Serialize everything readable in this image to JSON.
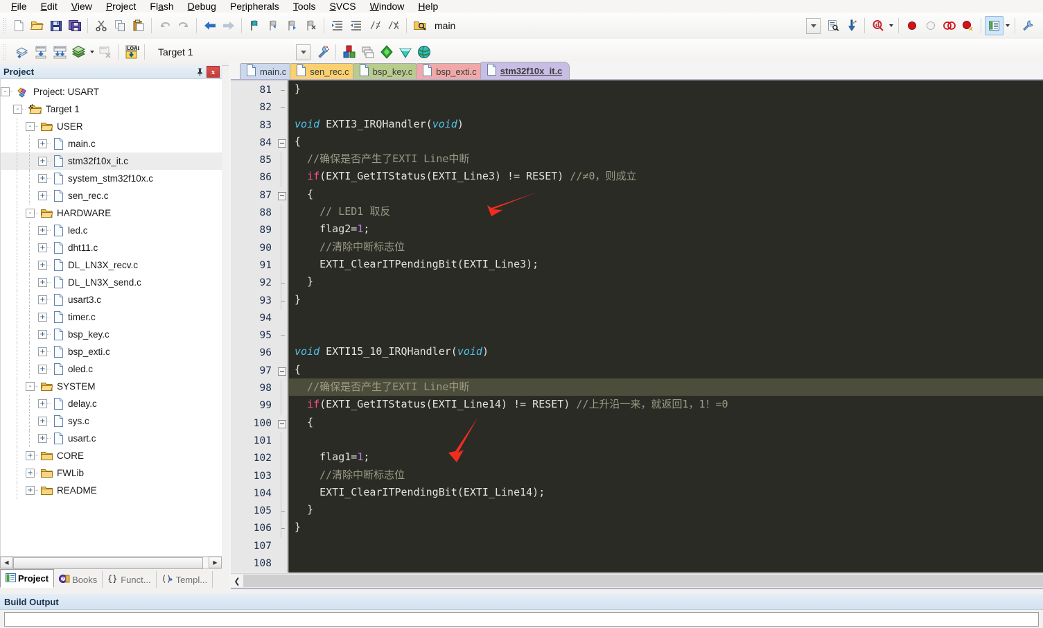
{
  "menubar": {
    "items": [
      "File",
      "Edit",
      "View",
      "Project",
      "Flash",
      "Debug",
      "Peripherals",
      "Tools",
      "SVCS",
      "Window",
      "Help"
    ]
  },
  "toolbar1": {
    "icons": [
      "new-file-icon",
      "open-file-icon",
      "save-icon",
      "save-all-icon",
      "cut-icon",
      "copy-icon",
      "paste-icon",
      "undo-icon",
      "redo-icon",
      "navigate-back-icon",
      "navigate-forward-icon",
      "bookmark-toggle-icon",
      "bookmark-prev-icon",
      "bookmark-next-icon",
      "bookmark-clear-icon",
      "indent-icon",
      "outdent-icon",
      "comment-icon",
      "uncomment-icon",
      "find-in-files-icon"
    ],
    "find_value": "main",
    "find_placeholder": "",
    "right_icons": [
      "combo-dropdown-icon",
      "bookmark-list-icon",
      "insert-icon",
      "debug-search-icon",
      "breakpoint-insert-icon",
      "breakpoint-disable-icon",
      "breakpoint-kill-all-icon",
      "breakpoint-disable-all-icon",
      "window-layout-icon",
      "configure-icon"
    ]
  },
  "toolbar2": {
    "icons": [
      "translate-icon",
      "build-icon",
      "rebuild-icon",
      "batch-build-icon",
      "batch-caret-icon",
      "stop-build-icon",
      "download-icon"
    ],
    "target_value": "Target 1",
    "target_placeholder": "",
    "right_icons": [
      "select-target-arrow-icon",
      "options-target-icon",
      "manage-components-icon",
      "manage-multi-project-icon",
      "pack-installer-icon",
      "run-pack-installer-icon",
      "manage-run-time-env-icon"
    ]
  },
  "project_panel": {
    "title": "Project",
    "pin_icon": "pin-icon",
    "close_icon": "close-icon",
    "tree": [
      {
        "label": "Project: USART",
        "depth": 0,
        "type": "project",
        "expander": "-",
        "selected": false
      },
      {
        "label": "Target 1",
        "depth": 1,
        "type": "target",
        "expander": "-",
        "selected": false
      },
      {
        "label": "USER",
        "depth": 2,
        "type": "group",
        "expander": "-",
        "selected": false
      },
      {
        "label": "main.c",
        "depth": 3,
        "type": "file",
        "expander": "+",
        "selected": false
      },
      {
        "label": "stm32f10x_it.c",
        "depth": 3,
        "type": "file",
        "expander": "+",
        "selected": true
      },
      {
        "label": "system_stm32f10x.c",
        "depth": 3,
        "type": "file",
        "expander": "+",
        "selected": false
      },
      {
        "label": "sen_rec.c",
        "depth": 3,
        "type": "file",
        "expander": "+",
        "selected": false
      },
      {
        "label": "HARDWARE",
        "depth": 2,
        "type": "group",
        "expander": "-",
        "selected": false
      },
      {
        "label": "led.c",
        "depth": 3,
        "type": "file",
        "expander": "+",
        "selected": false
      },
      {
        "label": "dht11.c",
        "depth": 3,
        "type": "file",
        "expander": "+",
        "selected": false
      },
      {
        "label": "DL_LN3X_recv.c",
        "depth": 3,
        "type": "file",
        "expander": "+",
        "selected": false
      },
      {
        "label": "DL_LN3X_send.c",
        "depth": 3,
        "type": "file",
        "expander": "+",
        "selected": false
      },
      {
        "label": "usart3.c",
        "depth": 3,
        "type": "file",
        "expander": "+",
        "selected": false
      },
      {
        "label": "timer.c",
        "depth": 3,
        "type": "file",
        "expander": "+",
        "selected": false
      },
      {
        "label": "bsp_key.c",
        "depth": 3,
        "type": "file",
        "expander": "+",
        "selected": false
      },
      {
        "label": "bsp_exti.c",
        "depth": 3,
        "type": "file",
        "expander": "+",
        "selected": false
      },
      {
        "label": "oled.c",
        "depth": 3,
        "type": "file",
        "expander": "+",
        "selected": false
      },
      {
        "label": "SYSTEM",
        "depth": 2,
        "type": "group",
        "expander": "-",
        "selected": false
      },
      {
        "label": "delay.c",
        "depth": 3,
        "type": "file",
        "expander": "+",
        "selected": false
      },
      {
        "label": "sys.c",
        "depth": 3,
        "type": "file",
        "expander": "+",
        "selected": false
      },
      {
        "label": "usart.c",
        "depth": 3,
        "type": "file",
        "expander": "+",
        "selected": false
      },
      {
        "label": "CORE",
        "depth": 2,
        "type": "folder",
        "expander": "+",
        "selected": false
      },
      {
        "label": "FWLib",
        "depth": 2,
        "type": "folder",
        "expander": "+",
        "selected": false
      },
      {
        "label": "README",
        "depth": 2,
        "type": "folder",
        "expander": "+",
        "selected": false
      }
    ],
    "tabs": [
      {
        "label": "Project",
        "icon": "project-icon",
        "active": true
      },
      {
        "label": "Books",
        "icon": "books-icon",
        "active": false
      },
      {
        "label": "Funct...",
        "icon": "functions-icon",
        "active": false
      },
      {
        "label": "Templ...",
        "icon": "templates-icon",
        "active": false
      }
    ]
  },
  "editor": {
    "file_tabs": [
      {
        "label": "main.c",
        "color": "#ccd8ec",
        "active": false
      },
      {
        "label": "sen_rec.c",
        "color": "#fbd170",
        "active": false
      },
      {
        "label": "bsp_key.c",
        "color": "#b9cc8e",
        "active": false
      },
      {
        "label": "bsp_exti.c",
        "color": "#f0a9a9",
        "active": false
      },
      {
        "label": "stm32f10x_it.c",
        "color": "#c8bde4",
        "active": true
      }
    ],
    "first_line_number": 81,
    "highlight_line": 98,
    "colors": {
      "background": "#2b2b26",
      "gutter": "#e7e7e7",
      "text": "#e3e3dd",
      "comment": "#9a9a86",
      "keyword": "#4fc3e8",
      "control_keyword": "#ff4d88",
      "number": "#b07cf0",
      "current_line": "#4d4d3c",
      "annotation_arrow": "#f22d1e"
    },
    "lines": [
      {
        "n": 81,
        "fold": "end",
        "segs": [
          {
            "t": "}"
          }
        ]
      },
      {
        "n": 82,
        "fold": "tail",
        "segs": []
      },
      {
        "n": 83,
        "fold": "none",
        "segs": [
          {
            "t": "void ",
            "c": "kw"
          },
          {
            "t": "EXTI3_IRQHandler("
          },
          {
            "t": "void",
            "c": "kw"
          },
          {
            "t": ")"
          }
        ]
      },
      {
        "n": 84,
        "fold": "start",
        "segs": [
          {
            "t": "{"
          }
        ]
      },
      {
        "n": 85,
        "fold": "none",
        "segs": [
          {
            "t": "  //确保是否产生了EXTI Line中断",
            "c": "cmt"
          }
        ]
      },
      {
        "n": 86,
        "fold": "none",
        "segs": [
          {
            "t": "  "
          },
          {
            "t": "if",
            "c": "kw2"
          },
          {
            "t": "(EXTI_GetITStatus(EXTI_Line3) != RESET) "
          },
          {
            "t": "//≠0，则成立",
            "c": "cmt"
          }
        ]
      },
      {
        "n": 87,
        "fold": "start",
        "segs": [
          {
            "t": "  {"
          }
        ]
      },
      {
        "n": 88,
        "fold": "none",
        "segs": [
          {
            "t": "    // LED1 取反",
            "c": "cmt"
          }
        ]
      },
      {
        "n": 89,
        "fold": "none",
        "segs": [
          {
            "t": "    flag2="
          },
          {
            "t": "1",
            "c": "num"
          },
          {
            "t": ";"
          }
        ]
      },
      {
        "n": 90,
        "fold": "none",
        "segs": [
          {
            "t": "    //清除中断标志位",
            "c": "cmt"
          }
        ]
      },
      {
        "n": 91,
        "fold": "none",
        "segs": [
          {
            "t": "    EXTI_ClearITPendingBit(EXTI_Line3);"
          }
        ]
      },
      {
        "n": 92,
        "fold": "end",
        "segs": [
          {
            "t": "  }"
          }
        ]
      },
      {
        "n": 93,
        "fold": "end",
        "segs": [
          {
            "t": "}"
          }
        ]
      },
      {
        "n": 94,
        "fold": "none",
        "segs": []
      },
      {
        "n": 95,
        "fold": "tail",
        "segs": []
      },
      {
        "n": 96,
        "fold": "none",
        "segs": [
          {
            "t": "void ",
            "c": "kw"
          },
          {
            "t": "EXTI15_10_IRQHandler("
          },
          {
            "t": "void",
            "c": "kw"
          },
          {
            "t": ")"
          }
        ]
      },
      {
        "n": 97,
        "fold": "start",
        "segs": [
          {
            "t": "{"
          }
        ]
      },
      {
        "n": 98,
        "fold": "none",
        "segs": [
          {
            "t": "  //确保是否产生了EXTI Line中断",
            "c": "cmt"
          }
        ]
      },
      {
        "n": 99,
        "fold": "none",
        "segs": [
          {
            "t": "  "
          },
          {
            "t": "if",
            "c": "kw2"
          },
          {
            "t": "(EXTI_GetITStatus(EXTI_Line14) != RESET) "
          },
          {
            "t": "//上升沿一来，就返回1，1！=0",
            "c": "cmt"
          }
        ]
      },
      {
        "n": 100,
        "fold": "start",
        "segs": [
          {
            "t": "  {"
          }
        ]
      },
      {
        "n": 101,
        "fold": "none",
        "segs": []
      },
      {
        "n": 102,
        "fold": "none",
        "segs": [
          {
            "t": "    flag1="
          },
          {
            "t": "1",
            "c": "num"
          },
          {
            "t": ";"
          }
        ]
      },
      {
        "n": 103,
        "fold": "none",
        "segs": [
          {
            "t": "    //清除中断标志位",
            "c": "cmt"
          }
        ]
      },
      {
        "n": 104,
        "fold": "none",
        "segs": [
          {
            "t": "    EXTI_ClearITPendingBit(EXTI_Line14);"
          }
        ]
      },
      {
        "n": 105,
        "fold": "end",
        "segs": [
          {
            "t": "  }"
          }
        ]
      },
      {
        "n": 106,
        "fold": "end",
        "segs": [
          {
            "t": "}"
          }
        ]
      },
      {
        "n": 107,
        "fold": "none",
        "segs": []
      },
      {
        "n": 108,
        "fold": "none",
        "segs": []
      }
    ],
    "annotations": [
      {
        "name": "red-arrow-line-88",
        "points_to": "// LED1 取反"
      },
      {
        "name": "red-arrow-line-102",
        "points_to": "flag1=1;"
      }
    ]
  },
  "build_output": {
    "title": "Build Output",
    "content": ""
  }
}
